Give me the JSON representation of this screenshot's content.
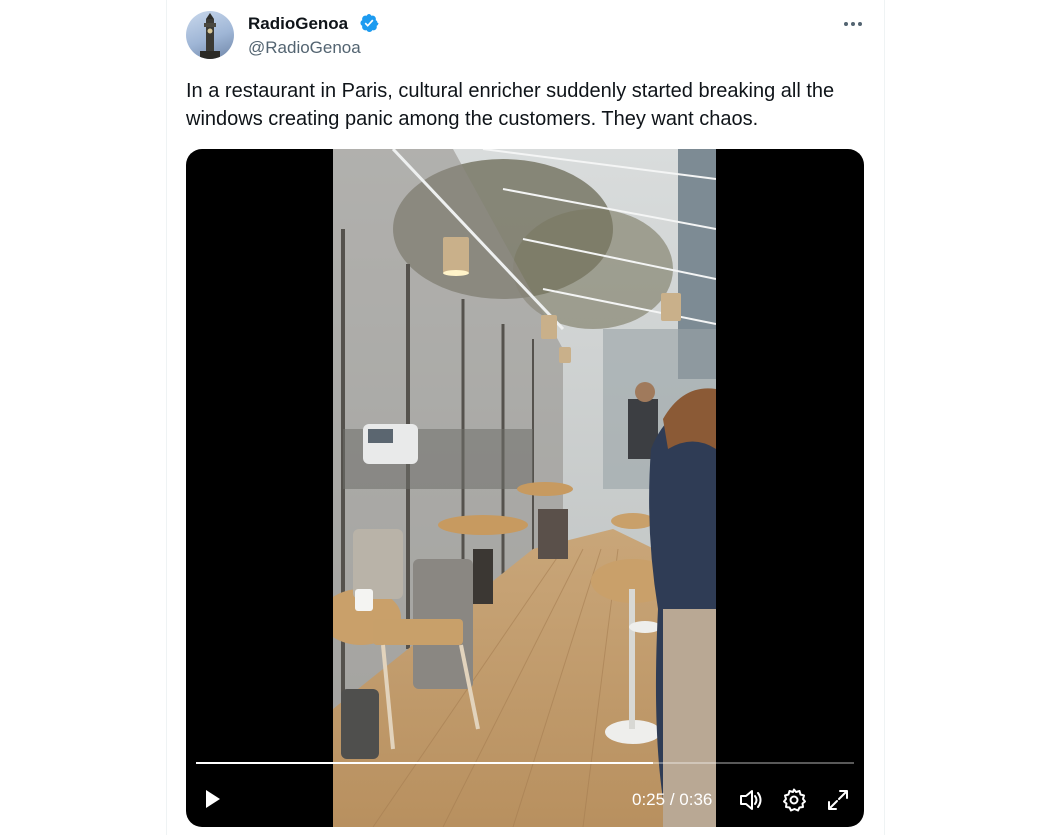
{
  "author": {
    "name": "RadioGenoa",
    "handle": "@RadioGenoa",
    "verified": true,
    "verified_color": "#1d9bf0"
  },
  "tweet": {
    "text": "In a restaurant in Paris, cultural enricher suddenly started breaking all the windows creating panic among the customers. They want chaos."
  },
  "video": {
    "current_time": "0:25",
    "separator": "/",
    "duration": "0:36",
    "progress_fraction": 0.694,
    "icons": [
      "play-icon",
      "volume-icon",
      "settings-gear-icon",
      "fullscreen-expand-icon"
    ]
  },
  "colors": {
    "text": "#0f1419",
    "secondary": "#536471",
    "verified": "#1d9bf0",
    "media_bg": "#000000"
  }
}
